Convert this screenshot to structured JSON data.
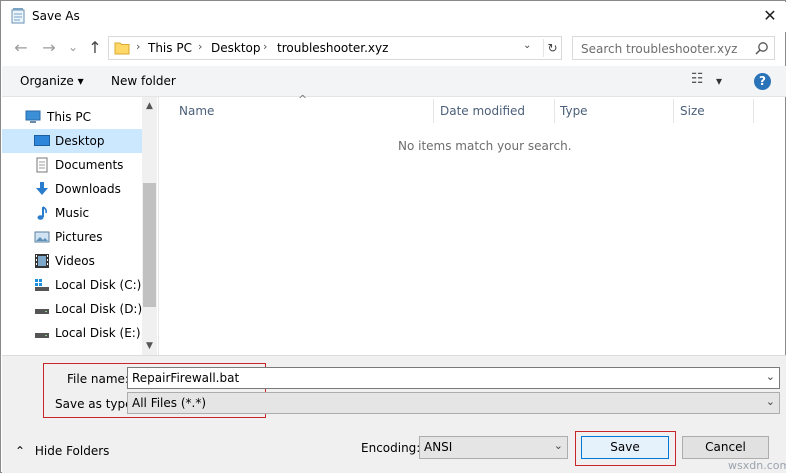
{
  "window": {
    "title": "Save As",
    "close_glyph": "✕"
  },
  "nav": {
    "back_glyph": "←",
    "forward_glyph": "→",
    "recent_glyph": "⌄",
    "up_glyph": "↑",
    "breadcrumb": [
      "This PC",
      "Desktop",
      "troubleshooter.xyz"
    ],
    "crumb_sep": "›",
    "search_placeholder": "Search troubleshooter.xyz"
  },
  "toolbar": {
    "organize": "Organize ▾",
    "new_folder": "New folder",
    "view_glyph": "☷",
    "view_drop": "▾",
    "help": "?"
  },
  "sidebar": {
    "items": [
      {
        "label": "This PC",
        "icon": "computer-icon"
      },
      {
        "label": "Desktop",
        "icon": "desktop-icon"
      },
      {
        "label": "Documents",
        "icon": "documents-icon"
      },
      {
        "label": "Downloads",
        "icon": "downloads-icon"
      },
      {
        "label": "Music",
        "icon": "music-icon"
      },
      {
        "label": "Pictures",
        "icon": "pictures-icon"
      },
      {
        "label": "Videos",
        "icon": "videos-icon"
      },
      {
        "label": "Local Disk (C:)",
        "icon": "os-drive-icon"
      },
      {
        "label": "Local Disk (D:)",
        "icon": "drive-icon"
      },
      {
        "label": "Local Disk (E:)",
        "icon": "drive-icon"
      }
    ]
  },
  "list": {
    "columns": [
      "Name",
      "Date modified",
      "Type",
      "Size"
    ],
    "sort_glyph": "^",
    "empty_message": "No items match your search."
  },
  "form": {
    "file_name_label": "File name:",
    "file_name_value": "RepairFirewall.bat",
    "save_type_label": "Save as type:",
    "save_type_value": "All Files  (*.*)",
    "encoding_label": "Encoding:",
    "encoding_value": "ANSI",
    "dropdown_glyph": "⌄"
  },
  "footer": {
    "hide_folders": "Hide Folders",
    "hide_glyph": "⌃",
    "save": "Save",
    "cancel": "Cancel"
  },
  "watermark": "wsxdn.com",
  "colors": {
    "accent": "#0078d7",
    "highlight": "#c9252b",
    "selection": "#cce8ff"
  }
}
